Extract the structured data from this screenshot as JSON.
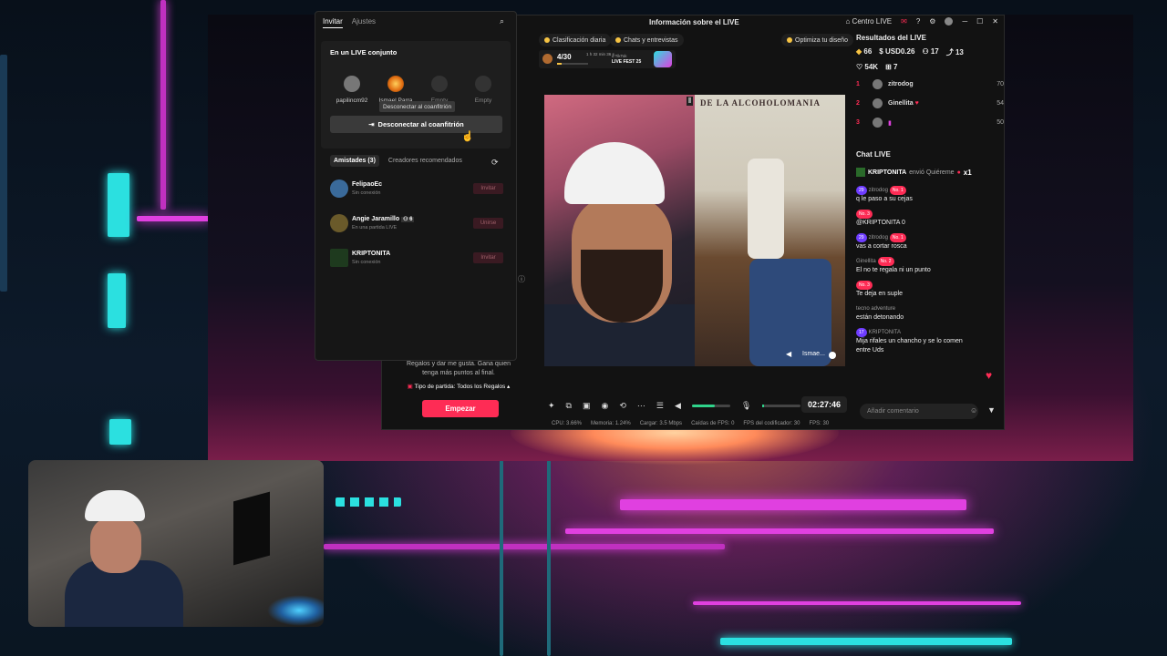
{
  "window": {
    "title": "Información sobre el LIVE",
    "centro_live": "Centro LIVE"
  },
  "top_chips": {
    "clasificacion": "Clasificación diaria",
    "chats": "Chats y entrevistas",
    "optimiza": "Optimiza tu diseño"
  },
  "progress": {
    "count": "4/30",
    "event": "LIVE FEST 25",
    "event_sub": "d TikTok",
    "time_left": "1 h 32 min 36 s"
  },
  "popup": {
    "tabs": [
      "Invitar",
      "Ajustes"
    ],
    "section_title": "En un LIVE conjunto",
    "slots": [
      {
        "name": "papilincm92"
      },
      {
        "name": "Ismael Parra"
      },
      {
        "name": "Empty"
      },
      {
        "name": "Empty"
      }
    ],
    "tooltip": "Desconectar al coanfitrión",
    "disconnect_button": "Desconectar al coanfitrión",
    "friend_tabs": [
      "Amistades (3)",
      "Creadores recomendados"
    ],
    "friends": [
      {
        "name": "FelipaoEc",
        "status": "Sin conexión",
        "button": "Invitar"
      },
      {
        "name": "Angie Jaramillo",
        "count": "6",
        "status": "En una partida LIVE",
        "button": "Unirse"
      },
      {
        "name": "KRIPTONITA",
        "status": "Sin conexión",
        "button": "Invitar"
      }
    ]
  },
  "left_pane": {
    "text_line1": "Regalos y dar me gusta. Gana quien",
    "text_line2": "tenga más puntos al final.",
    "match_type": "Tipo de partida: Todos los Regalos",
    "start_button": "Empezar"
  },
  "video": {
    "sign_text": "DE LA ALCOHOLOMANIA",
    "guest_label": "Ismae..."
  },
  "controls": {
    "timer": "02:27:46",
    "volume_level": 0.6
  },
  "stats_bar": {
    "cpu": "CPU: 3.66%",
    "memoria": "Memoria: 1.24%",
    "cargar": "Cargar: 3.5 Mbps",
    "caidas": "Caídas de FPS: 0",
    "fps_cod": "FPS del codificador: 30",
    "fps": "FPS: 30"
  },
  "results": {
    "title": "Resultados del LIVE",
    "coins": "66",
    "usd": "USD0.26",
    "viewers": "17",
    "shares": "13",
    "likes": "54K",
    "gifts": "7",
    "ranking": [
      {
        "rank": "1",
        "name": "zitrodog",
        "score": "70"
      },
      {
        "rank": "2",
        "name": "Ginellita",
        "score": "54"
      },
      {
        "rank": "3",
        "name": "",
        "score": "50"
      }
    ]
  },
  "chat": {
    "title": "Chat LIVE",
    "gift_banner": "KRIPTONITA",
    "gift_text": "envió Quiéreme",
    "gift_count": "x1",
    "messages": [
      {
        "level": "29",
        "user": "zitrodog",
        "rank": "No. 1",
        "text": "q le paso a su cejas"
      },
      {
        "level": "",
        "user": "",
        "rank": "No. 3",
        "text": "@KRIPTONITA 0"
      },
      {
        "level": "29",
        "user": "zitrodog",
        "rank": "No. 1",
        "text": "vas a cortar rosca"
      },
      {
        "level": "",
        "user": "Ginellita",
        "rank": "No. 2",
        "text": "El no te regala ni un punto"
      },
      {
        "level": "",
        "user": "",
        "rank": "No. 3",
        "text": "Te deja en suple"
      },
      {
        "level": "",
        "user": "tecno adventure",
        "rank": "",
        "text": "están detonando"
      },
      {
        "level": "17",
        "user": "KRIPTONITA",
        "rank": "",
        "text": "Mija rifales un chancho y se lo comen entre Uds"
      }
    ],
    "comment_placeholder": "Añadir comentario"
  },
  "colors": {
    "accent": "#fe2c55",
    "green": "#2fd38a",
    "neon_pink": "#e040e0",
    "neon_cyan": "#2be0e0"
  }
}
